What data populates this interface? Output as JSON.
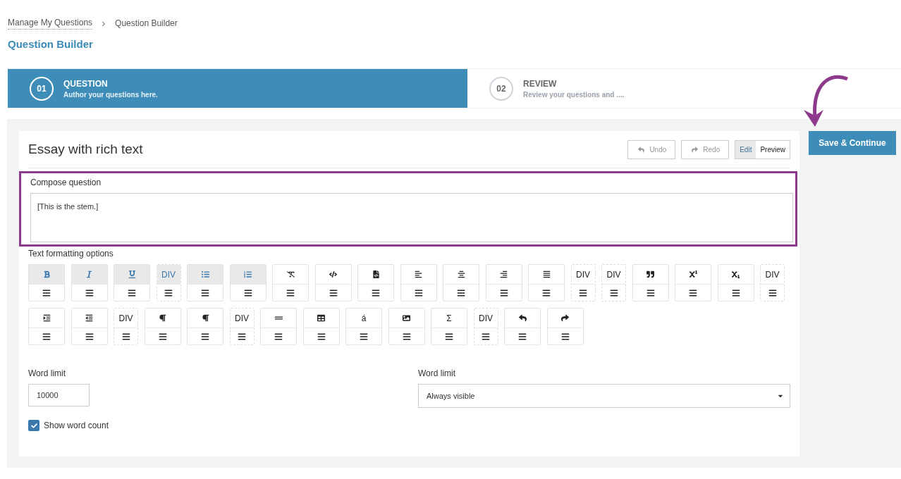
{
  "breadcrumb": [
    {
      "label": "Manage My Questions",
      "link": true
    },
    {
      "label": "Question Builder",
      "link": false
    }
  ],
  "page_title": "Question Builder",
  "steps": [
    {
      "number": "01",
      "title": "QUESTION",
      "subtitle": "Author your questions here.",
      "selected": true
    },
    {
      "number": "02",
      "title": "REVIEW",
      "subtitle": "Review your questions and ....",
      "selected": false
    }
  ],
  "save_button": "Save & Continue",
  "card": {
    "title": "Essay with rich text",
    "history_buttons": [
      {
        "kind": "undo",
        "label": "Undo"
      },
      {
        "kind": "redo",
        "label": "Redo"
      }
    ],
    "mode_tabs": [
      {
        "label": "Edit",
        "selected": true
      },
      {
        "label": "Preview",
        "selected": false
      }
    ],
    "compose": {
      "label": "Compose question",
      "value": "[This is the stem.]",
      "highlighted": true
    },
    "formatting": {
      "label": "Text formatting options",
      "rows": [
        [
          {
            "kind": "bold",
            "active": true
          },
          {
            "kind": "italic",
            "active": true
          },
          {
            "kind": "underline",
            "active": true
          },
          {
            "kind": "div",
            "label": "DIV",
            "active": true
          },
          {
            "kind": "bullets",
            "active": true
          },
          {
            "kind": "numbered",
            "active": true
          },
          {
            "kind": "clear",
            "active": false
          },
          {
            "kind": "code",
            "active": false
          },
          {
            "kind": "source",
            "active": false
          },
          {
            "kind": "align-left",
            "active": false
          },
          {
            "kind": "align-center",
            "active": false
          },
          {
            "kind": "align-right",
            "active": false
          },
          {
            "kind": "justify",
            "active": false
          },
          {
            "kind": "div",
            "label": "DIV",
            "active": false
          },
          {
            "kind": "div",
            "label": "DIV",
            "active": false
          },
          {
            "kind": "quote",
            "active": false
          },
          {
            "kind": "superscript",
            "active": false
          },
          {
            "kind": "subscript",
            "active": false
          },
          {
            "kind": "div",
            "label": "DIV",
            "active": false
          }
        ],
        [
          {
            "kind": "indent",
            "active": false
          },
          {
            "kind": "outdent",
            "active": false
          },
          {
            "kind": "div",
            "label": "DIV",
            "active": false
          },
          {
            "kind": "ltr",
            "active": false
          },
          {
            "kind": "rtl",
            "active": false
          },
          {
            "kind": "div",
            "label": "DIV",
            "active": false
          },
          {
            "kind": "rule",
            "active": false
          },
          {
            "kind": "table",
            "active": false
          },
          {
            "kind": "char",
            "label": "á",
            "active": false
          },
          {
            "kind": "image",
            "active": false
          },
          {
            "kind": "char",
            "label": "Σ",
            "active": false
          },
          {
            "kind": "div",
            "label": "DIV",
            "active": false
          },
          {
            "kind": "undo",
            "active": false
          },
          {
            "kind": "redo",
            "active": false
          }
        ]
      ]
    },
    "word_limit": {
      "label": "Word limit",
      "value": "10000"
    },
    "word_limit_display": {
      "label": "Word limit",
      "value": "Always visible"
    },
    "show_word_count": {
      "label": "Show word count",
      "checked": true
    }
  }
}
